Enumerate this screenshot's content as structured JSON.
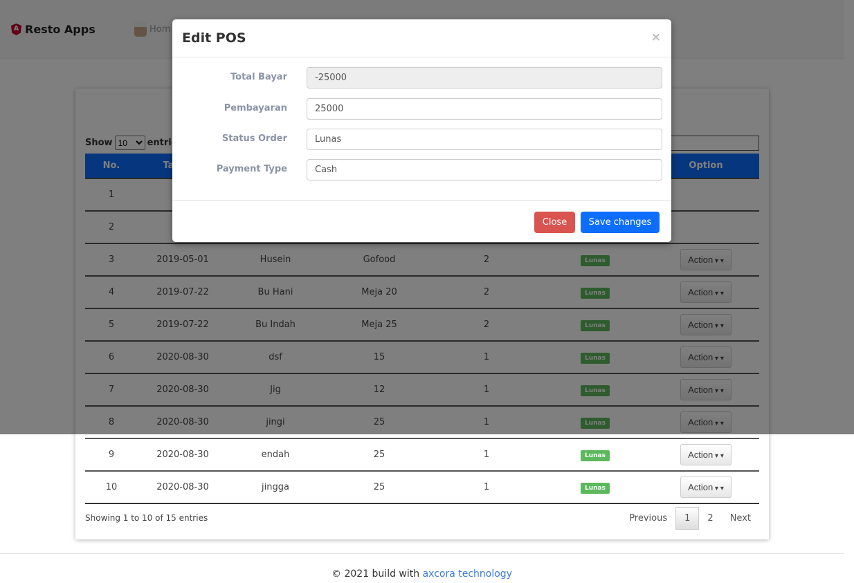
{
  "navbar": {
    "brand": "Resto Apps",
    "home": "Hom"
  },
  "table": {
    "show_label": "Show",
    "entries_value": "10",
    "entries_label": "entries",
    "headers": [
      "No.",
      "Tanggal",
      "",
      "",
      "",
      "",
      "Option"
    ],
    "rows": [
      [
        "1",
        "",
        "",
        "",
        "",
        "",
        ""
      ],
      [
        "2",
        "",
        "",
        "",
        "",
        "",
        ""
      ],
      [
        "3",
        "2019-05-01",
        "Husein",
        "Gofood",
        "2",
        "Lunas",
        "Action"
      ],
      [
        "4",
        "2019-07-22",
        "Bu Hani",
        "Meja 20",
        "2",
        "Lunas",
        "Action"
      ],
      [
        "5",
        "2019-07-22",
        "Bu Indah",
        "Meja 25",
        "2",
        "Lunas",
        "Action"
      ],
      [
        "6",
        "2020-08-30",
        "dsf",
        "15",
        "1",
        "Lunas",
        "Action"
      ],
      [
        "7",
        "2020-08-30",
        "Jig",
        "12",
        "1",
        "Lunas",
        "Action"
      ],
      [
        "8",
        "2020-08-30",
        "jingi",
        "25",
        "1",
        "Lunas",
        "Action"
      ],
      [
        "9",
        "2020-08-30",
        "endah",
        "25",
        "1",
        "Lunas",
        "Action"
      ],
      [
        "10",
        "2020-08-30",
        "jingga",
        "25",
        "1",
        "Lunas",
        "Action"
      ]
    ],
    "info": "Showing 1 to 10 of 15 entries",
    "pager": {
      "previous": "Previous",
      "pages": [
        "1",
        "2"
      ],
      "next": "Next"
    }
  },
  "footer": {
    "text": "© 2021 build with ",
    "link": "axcora technology"
  },
  "modal": {
    "title": "Edit POS",
    "close_x": "×",
    "fields": [
      {
        "label": "Total Bayar",
        "value": "-25000",
        "readonly": true
      },
      {
        "label": "Pembayaran",
        "value": "25000"
      },
      {
        "label": "Status Order",
        "value": "Lunas"
      },
      {
        "label": "Payment Type",
        "value": "Cash"
      }
    ],
    "close": "Close",
    "save": "Save changes"
  },
  "colors": {
    "primary": "#0d6efd",
    "danger": "#d9534f",
    "success": "#5cb85c",
    "link": "#3a7bd5"
  }
}
